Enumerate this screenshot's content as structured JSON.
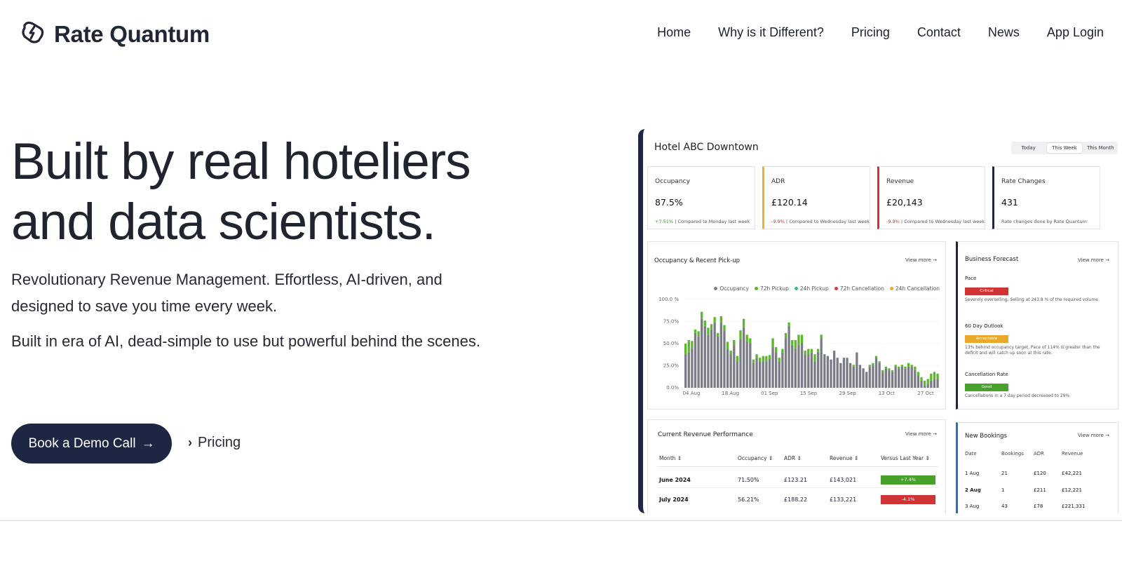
{
  "brand": {
    "name": "Rate Quantum"
  },
  "nav": [
    {
      "label": "Home"
    },
    {
      "label": "Why is it Different?"
    },
    {
      "label": "Pricing"
    },
    {
      "label": "Contact"
    },
    {
      "label": "News"
    },
    {
      "label": "App Login"
    }
  ],
  "hero": {
    "headline_line1": "Built by real hoteliers",
    "headline_line2": "and data scientists.",
    "paragraph1": "Revolutionary Revenue Management. Effortless, AI-driven, and designed to save you time every week.",
    "paragraph2": "Built in era of AI, dead-simple to use but powerful behind the scenes.",
    "cta_label": "Book a Demo Call",
    "cta_arrow": "→",
    "secondary_label": "Pricing",
    "secondary_chevron": "›"
  },
  "dashboard": {
    "title": "Hotel ABC Downtown",
    "ranges": [
      "Today",
      "This Week",
      "This Month"
    ],
    "active_range": "This Week",
    "kpis": [
      {
        "label": "Occupancy",
        "value": "87.5%",
        "delta": "+7.51%",
        "delta_dir": "up",
        "note": "Compared to Monday last week"
      },
      {
        "label": "ADR",
        "value": "£120.14",
        "delta": "-9.9%",
        "delta_dir": "down",
        "note": "Compared to Wednesday last week"
      },
      {
        "label": "Revenue",
        "value": "£20,143",
        "delta": "-9.9%",
        "delta_dir": "down",
        "note": "Compared to Wednesday last week"
      },
      {
        "label": "Rate Changes",
        "value": "431",
        "delta": "",
        "delta_dir": "",
        "note": "Rate changes done by Rate Quantum"
      }
    ],
    "occupancy_chart": {
      "title": "Occupancy & Recent Pick-up",
      "view_more": "View more →",
      "legend": [
        {
          "name": "Occupancy",
          "color": "#7a7b87"
        },
        {
          "name": "72h Pickup",
          "color": "#5cb82a"
        },
        {
          "name": "24h Pickup",
          "color": "#2fb8a3"
        },
        {
          "name": "72h Cancellation",
          "color": "#d23b3b"
        },
        {
          "name": "24h Cancellation",
          "color": "#f0a52a"
        }
      ]
    },
    "chart_data": {
      "type": "bar",
      "stacked": true,
      "title": "Occupancy & Recent Pick-up",
      "ylim": [
        0,
        100
      ],
      "yticks": [
        "0.0%",
        "25.0%",
        "50.0%",
        "75.0%",
        "100.0 %"
      ],
      "xticks": [
        "04 Aug",
        "18 Aug",
        "01 Sep",
        "15 Sep",
        "29 Sep",
        "13 Oct",
        "27 Oct"
      ],
      "occupancy": [
        38,
        40,
        45,
        62,
        58,
        78,
        70,
        60,
        66,
        74,
        58,
        73,
        65,
        44,
        38,
        48,
        30,
        55,
        68,
        52,
        50,
        28,
        34,
        30,
        30,
        30,
        33,
        46,
        40,
        30,
        40,
        56,
        70,
        48,
        44,
        48,
        50,
        38,
        38,
        40,
        30,
        40,
        56,
        38,
        36,
        32,
        42,
        34,
        28,
        34,
        34,
        28,
        24,
        40,
        26,
        22,
        18,
        24,
        26,
        34,
        28,
        18,
        22,
        20,
        18,
        24,
        22,
        24,
        22,
        24,
        24,
        20,
        14,
        8,
        2,
        4,
        8,
        10,
        10
      ],
      "pickup72": [
        12,
        14,
        8,
        4,
        6,
        8,
        6,
        8,
        6,
        6,
        4,
        8,
        6,
        8,
        4,
        6,
        6,
        10,
        10,
        8,
        6,
        4,
        4,
        4,
        6,
        6,
        4,
        10,
        6,
        4,
        4,
        6,
        4,
        6,
        10,
        12,
        10,
        4,
        6,
        4,
        8,
        4,
        4,
        0,
        0,
        0,
        0,
        0,
        0,
        0,
        0,
        0,
        2,
        0,
        0,
        0,
        0,
        2,
        2,
        2,
        2,
        2,
        2,
        2,
        2,
        2,
        2,
        2,
        2,
        4,
        2,
        4,
        4,
        4,
        6,
        6,
        8,
        8,
        6
      ],
      "cancel72": [
        0,
        0,
        0,
        0,
        0,
        0,
        0,
        0,
        0,
        0,
        0,
        0,
        0,
        0,
        0,
        0,
        0,
        0,
        0,
        0,
        0,
        0,
        0,
        0,
        0,
        0,
        0,
        0,
        0,
        0,
        0,
        0,
        0,
        0,
        0,
        0,
        0,
        0,
        0,
        0,
        0,
        0,
        0,
        0,
        0,
        0,
        0,
        0,
        0,
        0,
        0,
        0,
        0,
        0,
        0,
        0,
        0,
        0,
        0,
        0,
        0,
        0,
        0,
        0,
        0,
        0,
        0,
        0,
        0,
        0,
        0,
        0,
        0,
        0,
        0,
        0,
        0,
        0,
        0
      ],
      "cancel24": [
        0,
        0,
        0,
        0,
        0,
        0,
        0,
        0,
        0,
        0,
        0,
        0,
        0,
        0,
        0,
        0,
        0,
        0,
        0,
        0,
        0,
        0,
        0,
        0,
        0,
        0,
        0,
        0,
        0,
        0,
        0,
        0,
        0,
        0,
        0,
        0,
        0,
        0,
        0,
        0,
        0,
        0,
        0,
        0,
        0,
        0,
        0,
        0,
        0,
        0,
        0,
        0,
        0,
        0,
        0,
        0,
        0,
        0,
        0,
        0,
        0,
        0,
        0,
        0,
        0,
        0,
        0,
        0,
        0,
        0,
        0,
        0,
        0,
        0,
        0,
        0,
        0,
        0,
        0
      ]
    },
    "forecast": {
      "title": "Business Forecast",
      "view_more": "View more →",
      "items": [
        {
          "title": "Pace",
          "badge": "Critical",
          "badge_color": "#cf3434",
          "desc": "Severely overselling. Selling at 243.8 % of the required volume."
        },
        {
          "title": "60 Day Outlook",
          "badge": "Acceptable",
          "badge_color": "#e8a82a",
          "desc": "13% behind occupancy target. Pace of 114% is greater than the deficit and will catch up soon at this rate."
        },
        {
          "title": "Cancellation Rate",
          "badge": "Good",
          "badge_color": "#47a12a",
          "desc": "Cancellations in a 7 day period decreased to 29%"
        }
      ]
    },
    "revenue": {
      "title": "Current Revenue Performance",
      "view_more": "View more →",
      "headers": [
        "Month ⇕",
        "Occupancy ⇕",
        "ADR ⇕",
        "Revenue ⇕",
        "Versus Last Year ⇕"
      ],
      "rows": [
        {
          "month": "June 2024",
          "occupancy": "71.50%",
          "adr": "£123.21",
          "revenue": "£143,021",
          "vs": "+7.4%",
          "vs_color": "#47a12a"
        },
        {
          "month": "July 2024",
          "occupancy": "56.21%",
          "adr": "£188.22",
          "revenue": "£133,221",
          "vs": "-4.1%",
          "vs_color": "#cf3434"
        }
      ]
    },
    "bookings": {
      "title": "New Bookings",
      "view_more": "View more →",
      "headers": [
        "Date",
        "Bookings",
        "ADR",
        "Revenue"
      ],
      "rows": [
        {
          "date": "1 Aug",
          "bookings": "21",
          "adr": "£120",
          "revenue": "£42,221"
        },
        {
          "date": "2 Aug",
          "bookings": "1",
          "adr": "£211",
          "revenue": "£12,221"
        },
        {
          "date": "3 Aug",
          "bookings": "43",
          "adr": "£78",
          "revenue": "£221,331"
        }
      ]
    }
  }
}
